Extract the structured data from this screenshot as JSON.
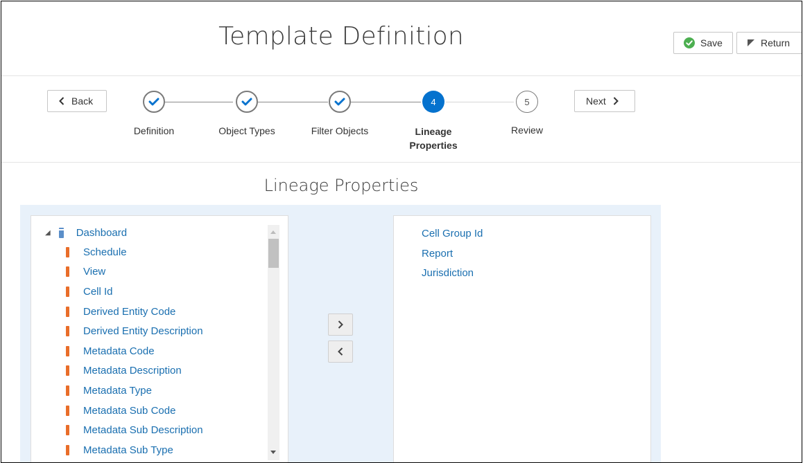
{
  "header": {
    "title": "Template Definition",
    "save_label": "Save",
    "return_label": "Return"
  },
  "train": {
    "back_label": "Back",
    "next_label": "Next",
    "steps": [
      {
        "label": "Definition",
        "state": "done"
      },
      {
        "label": "Object Types",
        "state": "done"
      },
      {
        "label": "Filter Objects",
        "state": "done"
      },
      {
        "label": "Lineage Properties",
        "number": "4",
        "state": "current"
      },
      {
        "label": "Review",
        "number": "5",
        "state": "future"
      }
    ]
  },
  "section": {
    "title": "Lineage Properties"
  },
  "available": {
    "root": "Dashboard",
    "items": [
      "Schedule",
      "View",
      "Cell Id",
      "Derived Entity Code",
      "Derived Entity Description",
      "Metadata Code",
      "Metadata Description",
      "Metadata Type",
      "Metadata Sub Code",
      "Metadata Sub Description",
      "Metadata Sub Type"
    ]
  },
  "selected": {
    "items": [
      "Cell Group Id",
      "Report",
      "Jurisdiction"
    ]
  },
  "colors": {
    "accent": "#0572ce",
    "link": "#1a6fb0",
    "leaf_icon": "#e96d29",
    "save_icon": "#4caf50",
    "shuttle_bg": "#e8f1fa"
  }
}
